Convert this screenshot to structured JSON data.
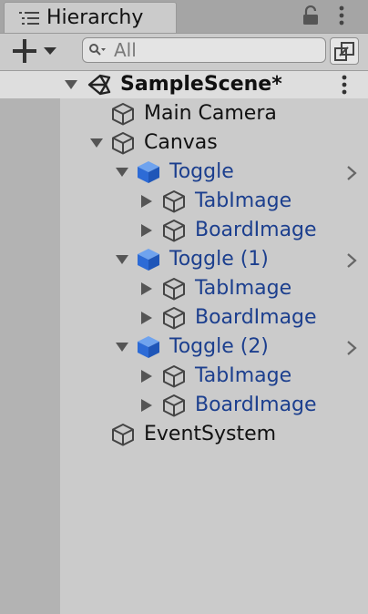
{
  "window": {
    "tab_title": "Hierarchy",
    "icons": {
      "tab": "hierarchy-list-icon",
      "lock": "lock-icon",
      "menu": "kebab-menu-icon"
    }
  },
  "toolbar": {
    "create_icon": "plus-with-dropdown-icon",
    "search": {
      "placeholder": "All",
      "value": "",
      "icon": "search-icon"
    },
    "scene_visibility_icon": "scene-visibility-icon"
  },
  "scene": {
    "name": "SampleScene*",
    "expanded": true,
    "icon": "unity-logo-icon"
  },
  "hierarchy": [
    {
      "label": "Main Camera",
      "type": "gameobject",
      "depth": 0,
      "expandable": false
    },
    {
      "label": "Canvas",
      "type": "gameobject",
      "depth": 0,
      "expandable": true,
      "expanded": true
    },
    {
      "label": "Toggle",
      "type": "prefab",
      "depth": 1,
      "expandable": true,
      "expanded": true,
      "has_prefab_arrow": true
    },
    {
      "label": "TabImage",
      "type": "prefab-child",
      "depth": 2,
      "expandable": true,
      "expanded": false
    },
    {
      "label": "BoardImage",
      "type": "prefab-child",
      "depth": 2,
      "expandable": true,
      "expanded": false
    },
    {
      "label": "Toggle (1)",
      "type": "prefab",
      "depth": 1,
      "expandable": true,
      "expanded": true,
      "has_prefab_arrow": true
    },
    {
      "label": "TabImage",
      "type": "prefab-child",
      "depth": 2,
      "expandable": true,
      "expanded": false
    },
    {
      "label": "BoardImage",
      "type": "prefab-child",
      "depth": 2,
      "expandable": true,
      "expanded": false
    },
    {
      "label": "Toggle (2)",
      "type": "prefab",
      "depth": 1,
      "expandable": true,
      "expanded": true,
      "has_prefab_arrow": true
    },
    {
      "label": "TabImage",
      "type": "prefab-child",
      "depth": 2,
      "expandable": true,
      "expanded": false
    },
    {
      "label": "BoardImage",
      "type": "prefab-child",
      "depth": 2,
      "expandable": true,
      "expanded": false
    },
    {
      "label": "EventSystem",
      "type": "gameobject",
      "depth": 0,
      "expandable": false
    }
  ],
  "colors": {
    "prefab_text": "#1c3f8e",
    "prefab_icon": "#2d6bd6",
    "panel_bg": "#cbcbcb",
    "gutter_bg": "#b3b3b3",
    "scene_header_bg": "#dedede"
  }
}
